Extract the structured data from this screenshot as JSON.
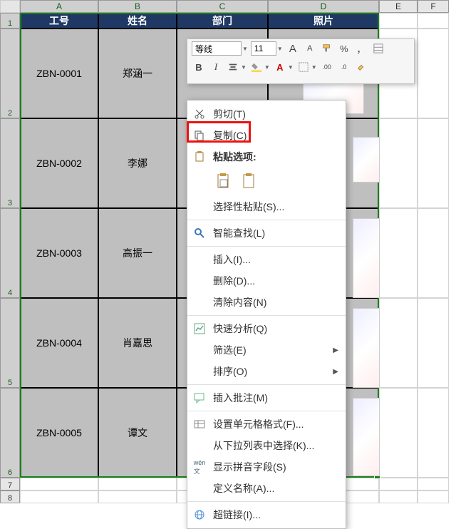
{
  "columns": [
    "A",
    "B",
    "C",
    "D",
    "E",
    "F"
  ],
  "rowNumbers": [
    "1",
    "2",
    "3",
    "4",
    "5",
    "6",
    "7",
    "8"
  ],
  "headers": {
    "code": "工号",
    "name": "姓名",
    "dept": "部门",
    "photo": "照片"
  },
  "table": [
    {
      "code": "ZBN-0001",
      "name": "郑涵一"
    },
    {
      "code": "ZBN-0002",
      "name": "李娜"
    },
    {
      "code": "ZBN-0003",
      "name": "高振一"
    },
    {
      "code": "ZBN-0004",
      "name": "肖嘉思"
    },
    {
      "code": "ZBN-0005",
      "name": "谭文"
    }
  ],
  "miniToolbar": {
    "fontName": "等线",
    "fontSize": "11",
    "buttons": {
      "growFont": "A",
      "shrinkFont": "A",
      "percent": "%",
      "comma": "，",
      "bold": "B",
      "italic": "I"
    }
  },
  "contextMenu": {
    "cut": "剪切(T)",
    "copy": "复制(C)",
    "pasteOptions": "粘贴选项:",
    "pasteSpecial": "选择性粘贴(S)...",
    "smartLookup": "智能查找(L)",
    "insert": "插入(I)...",
    "delete": "删除(D)...",
    "clearContents": "清除内容(N)",
    "quickAnalysis": "快速分析(Q)",
    "filter": "筛选(E)",
    "sort": "排序(O)",
    "insertComment": "插入批注(M)",
    "formatCells": "设置单元格格式(F)...",
    "pickFromDropDown": "从下拉列表中选择(K)...",
    "showPhonetic": "显示拼音字段(S)",
    "defineName": "定义名称(A)...",
    "hyperlink": "超链接(I)..."
  }
}
